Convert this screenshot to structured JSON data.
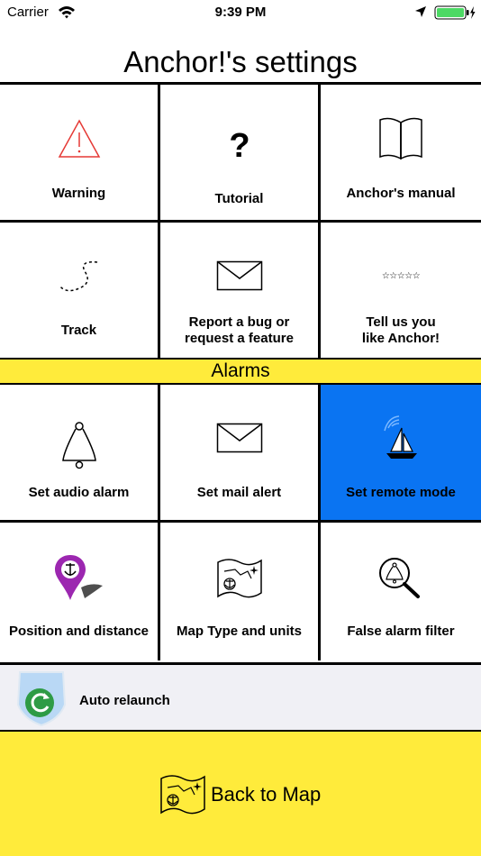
{
  "status_bar": {
    "carrier": "Carrier",
    "time": "9:39 PM",
    "battery_color": "#4cd964"
  },
  "page_title": "Anchor!'s settings",
  "general_rows": [
    [
      {
        "label": "Warning",
        "icon": "warning-triangle-icon"
      },
      {
        "label": "Tutorial",
        "icon": "question-mark-icon"
      },
      {
        "label": "Anchor's manual",
        "icon": "open-book-icon"
      }
    ],
    [
      {
        "label": "Track",
        "icon": "dashed-track-icon"
      },
      {
        "label_line1": "Report a bug or",
        "label_line2": "request a feature",
        "icon": "envelope-icon"
      },
      {
        "label_line1": "Tell us you",
        "label_line2": "like Anchor!",
        "icon": "stars-rating-icon"
      }
    ]
  ],
  "alarms": {
    "header": "Alarms",
    "rows": [
      [
        {
          "label": "Set audio alarm",
          "icon": "bell-icon"
        },
        {
          "label": "Set mail alert",
          "icon": "envelope-icon"
        },
        {
          "label": "Set remote mode",
          "icon": "sailboat-signal-icon",
          "active": true
        }
      ],
      [
        {
          "label": "Position and distance",
          "icon": "anchor-pin-icon"
        },
        {
          "label": "Map Type and units",
          "icon": "treasure-map-icon"
        },
        {
          "label": "False alarm filter",
          "icon": "magnifier-bell-icon"
        }
      ]
    ]
  },
  "auto_relaunch": {
    "label": "Auto relaunch",
    "icon": "shield-refresh-icon"
  },
  "back_button": {
    "label": "Back to Map",
    "icon": "treasure-map-icon"
  },
  "colors": {
    "accent_yellow": "#ffeb3b",
    "active_blue": "#0a74f2",
    "warning_red": "#e53935",
    "pin_purple": "#9c27b0",
    "refresh_green": "#2e9b45"
  }
}
